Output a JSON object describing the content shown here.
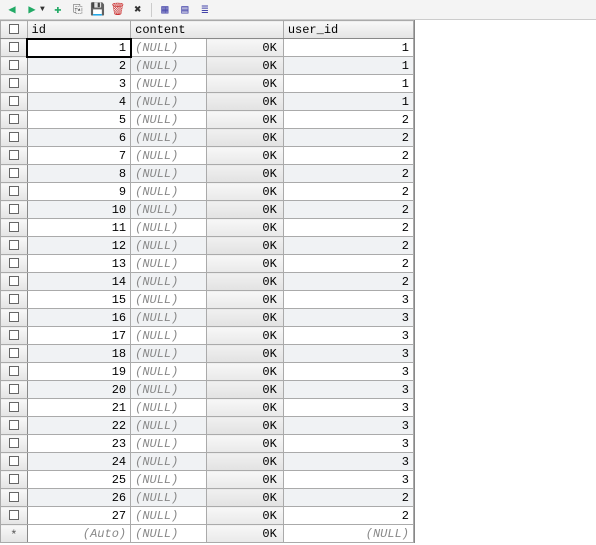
{
  "toolbar": {
    "icons": [
      {
        "name": "nav-back-icon",
        "glyph": "◀",
        "color": "#2a6"
      },
      {
        "name": "nav-fwd-icon",
        "glyph": "▶",
        "color": "#2a6",
        "hasDrop": true
      },
      {
        "name": "add-row-icon",
        "glyph": "✚",
        "color": "#2a6"
      },
      {
        "name": "copy-row-icon",
        "glyph": "⎘",
        "color": "#555"
      },
      {
        "name": "save-icon",
        "glyph": "💾",
        "color": "#555"
      },
      {
        "name": "delete-icon",
        "glyph": "🗑",
        "color": "#c33"
      },
      {
        "name": "cancel-icon",
        "glyph": "✖",
        "color": "#333"
      },
      {
        "name": "sep"
      },
      {
        "name": "grid-view-icon",
        "glyph": "▦",
        "color": "#44a"
      },
      {
        "name": "form-view-icon",
        "glyph": "▤",
        "color": "#44a"
      },
      {
        "name": "text-view-icon",
        "glyph": "≣",
        "color": "#44a"
      }
    ]
  },
  "columns": {
    "id": "id",
    "content": "content",
    "user_id": "user_id"
  },
  "null_text": "(NULL)",
  "size_text": "0K",
  "auto_text": "(Auto)",
  "rows": [
    {
      "id": "1",
      "user_id": "1",
      "sel": true
    },
    {
      "id": "2",
      "user_id": "1"
    },
    {
      "id": "3",
      "user_id": "1"
    },
    {
      "id": "4",
      "user_id": "1"
    },
    {
      "id": "5",
      "user_id": "2"
    },
    {
      "id": "6",
      "user_id": "2"
    },
    {
      "id": "7",
      "user_id": "2"
    },
    {
      "id": "8",
      "user_id": "2"
    },
    {
      "id": "9",
      "user_id": "2"
    },
    {
      "id": "10",
      "user_id": "2"
    },
    {
      "id": "11",
      "user_id": "2"
    },
    {
      "id": "12",
      "user_id": "2"
    },
    {
      "id": "13",
      "user_id": "2"
    },
    {
      "id": "14",
      "user_id": "2"
    },
    {
      "id": "15",
      "user_id": "3"
    },
    {
      "id": "16",
      "user_id": "3"
    },
    {
      "id": "17",
      "user_id": "3"
    },
    {
      "id": "18",
      "user_id": "3"
    },
    {
      "id": "19",
      "user_id": "3"
    },
    {
      "id": "20",
      "user_id": "3"
    },
    {
      "id": "21",
      "user_id": "3"
    },
    {
      "id": "22",
      "user_id": "3"
    },
    {
      "id": "23",
      "user_id": "3"
    },
    {
      "id": "24",
      "user_id": "3"
    },
    {
      "id": "25",
      "user_id": "3"
    },
    {
      "id": "26",
      "user_id": "2"
    },
    {
      "id": "27",
      "user_id": "2"
    }
  ]
}
